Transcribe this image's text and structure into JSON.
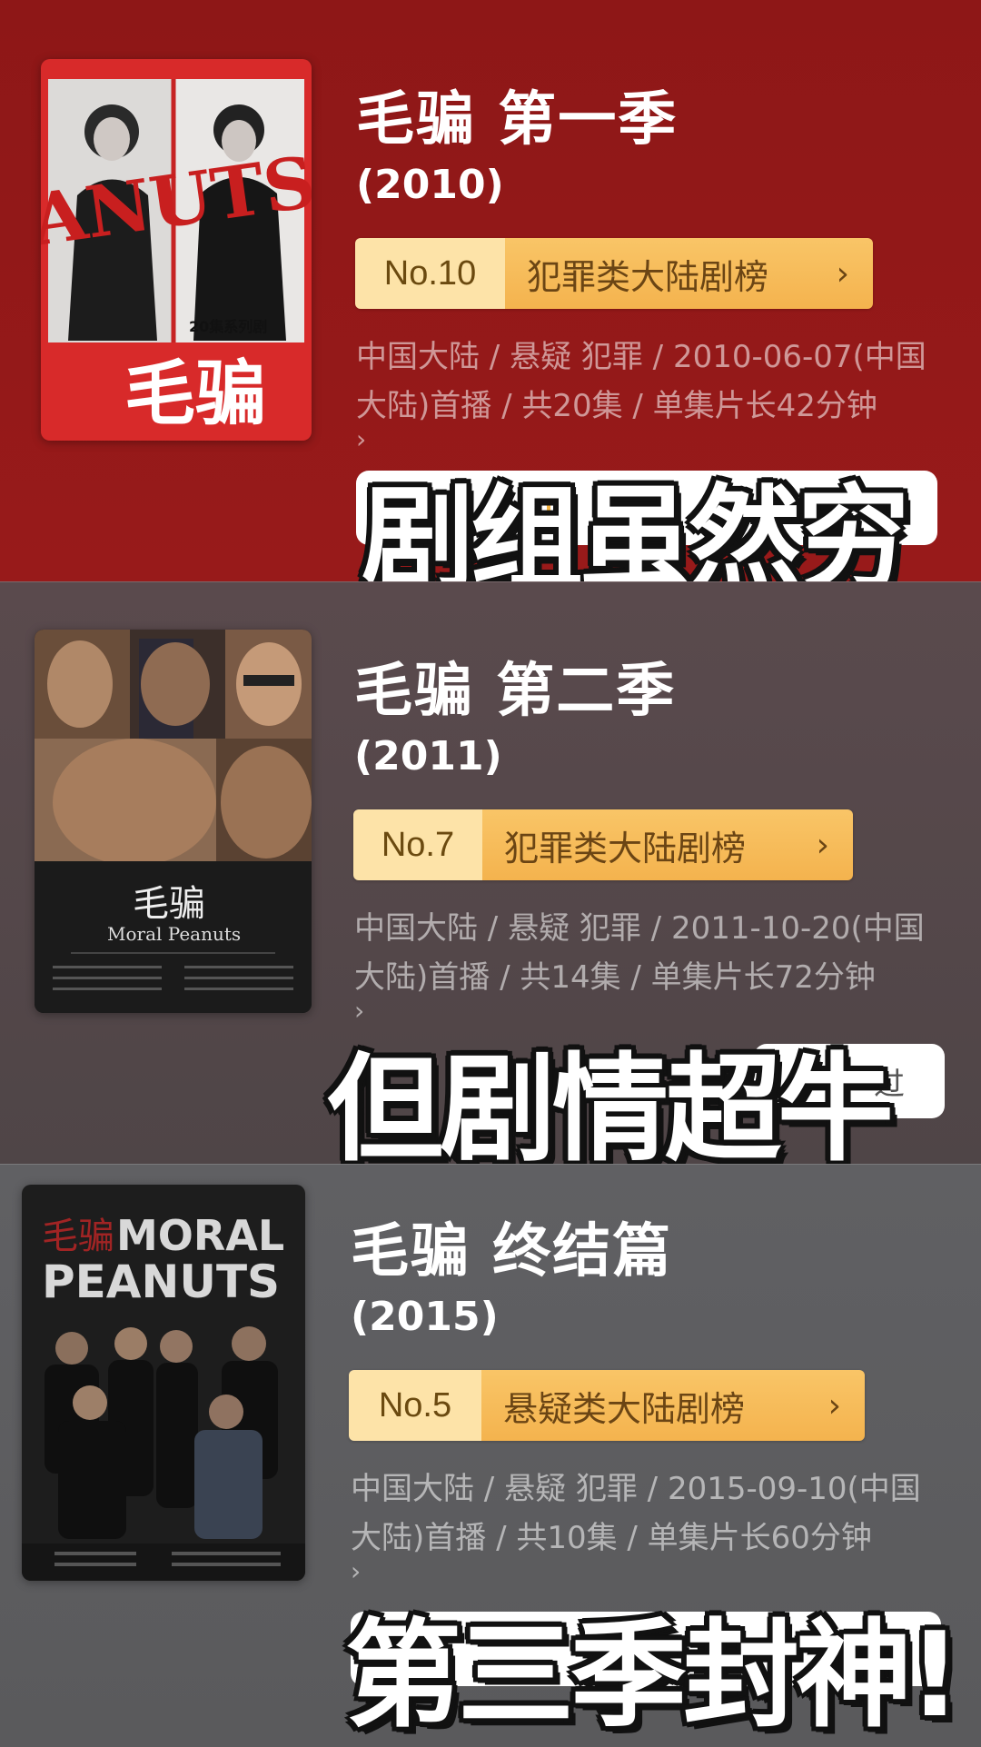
{
  "shows": [
    {
      "title": "毛骗 第一季",
      "year": "(2010)",
      "rank_no": "No.10",
      "rank_list": "犯罪类大陆剧榜",
      "meta": "中国大陆 / 悬疑 犯罪 / 2010-06-07(中国大陆)首播 / 共20集 / 单集片长42分钟",
      "poster_title": "毛骗",
      "poster_band": "ANUTS",
      "poster_tag": "20集系列剧",
      "overlay": "剧组虽然穷"
    },
    {
      "title": "毛骗 第二季",
      "year": "(2011)",
      "rank_no": "No.7",
      "rank_list": "犯罪类大陆剧榜",
      "meta": "中国大陆 / 悬疑 犯罪 / 2011-10-20(中国大陆)首播 / 共14集 / 单集片长72分钟",
      "poster_title": "毛骗",
      "poster_subtitle": "Moral Peanuts",
      "pill_text": "过",
      "overlay": "但剧情超牛"
    },
    {
      "title": "毛骗 终结篇",
      "year": "(2015)",
      "rank_no": "No.5",
      "rank_list": "悬疑类大陆剧榜",
      "meta": "中国大陆 / 悬疑 犯罪 / 2015-09-10(中国大陆)首播 / 共10集 / 单集片长60分钟",
      "poster_title_cn": "毛骗",
      "poster_title_en1": "MORAL",
      "poster_title_en2": "PEANUTS",
      "overlay": "第三季封神!"
    }
  ],
  "ui": {
    "chevron": "›",
    "meta_chevron": "›"
  },
  "colors": {
    "accent": "#f4b34e",
    "section1": "#971a1a",
    "section2": "#564a4c",
    "section3": "#5d5d5f"
  }
}
